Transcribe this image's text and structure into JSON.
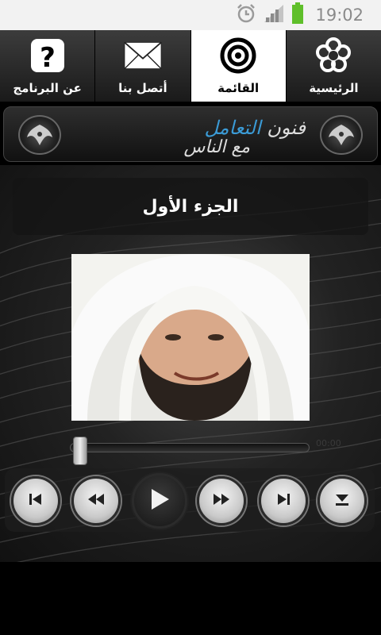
{
  "status_bar": {
    "time": "19:02",
    "icons": [
      "alarm-icon",
      "signal-icon",
      "battery-icon"
    ]
  },
  "nav": {
    "items": [
      {
        "label": "عن البرنامج",
        "icon": "question-icon"
      },
      {
        "label": "أتصل بنا",
        "icon": "envelope-icon"
      },
      {
        "label": "القائمة",
        "icon": "target-icon",
        "active": true
      },
      {
        "label": "الرئيسية",
        "icon": "flower-icon"
      }
    ]
  },
  "banner": {
    "line1_prefix": "فنون ",
    "line1_highlight": "التعامل",
    "line2": "مع الناس"
  },
  "player": {
    "part_title": "الجزء الأول",
    "time_text": "00:00",
    "progress": 0
  },
  "controls": [
    "previous-track-icon",
    "rewind-icon",
    "play-icon",
    "fast-forward-icon",
    "next-track-icon",
    "download-icon"
  ],
  "colors": {
    "accent_blue": "#3b9bd6",
    "battery_green": "#5fbf2a",
    "nav_active_bg": "#ffffff"
  }
}
